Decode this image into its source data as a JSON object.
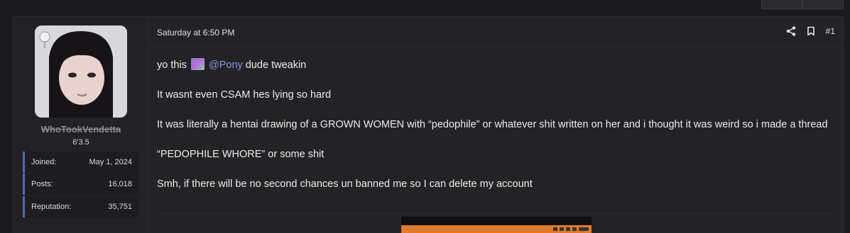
{
  "post": {
    "timestamp": "Saturday at 6:50 PM",
    "post_number": "#1",
    "user": {
      "username": "WhoTookVendetta",
      "title": "6'3.5",
      "stats": [
        {
          "label": "Joined:",
          "value": "May 1, 2024"
        },
        {
          "label": "Posts:",
          "value": "16,018"
        },
        {
          "label": "Reputation:",
          "value": "35,751"
        }
      ]
    },
    "content": {
      "line1_prefix": "yo this",
      "mention": "@Pony",
      "line1_suffix": "dude tweakin",
      "para2": "It wasnt even CSAM hes lying so hard",
      "para3": "It was literally a hentai drawing of a GROWN WOMEN with “pedophile” or whatever shit written on her and i thought it was weird so i made a thread",
      "para4": "“PEDOPHILE WHORE” or some shit",
      "para5": "Smh, if there will be no second chances un banned me so I can delete my account"
    },
    "icons": {
      "share": "share-icon",
      "bookmark": "bookmark-icon"
    }
  },
  "colors": {
    "accent": "#5a6ab8",
    "mention": "#8a95e8",
    "background": "#1b1b1d"
  }
}
